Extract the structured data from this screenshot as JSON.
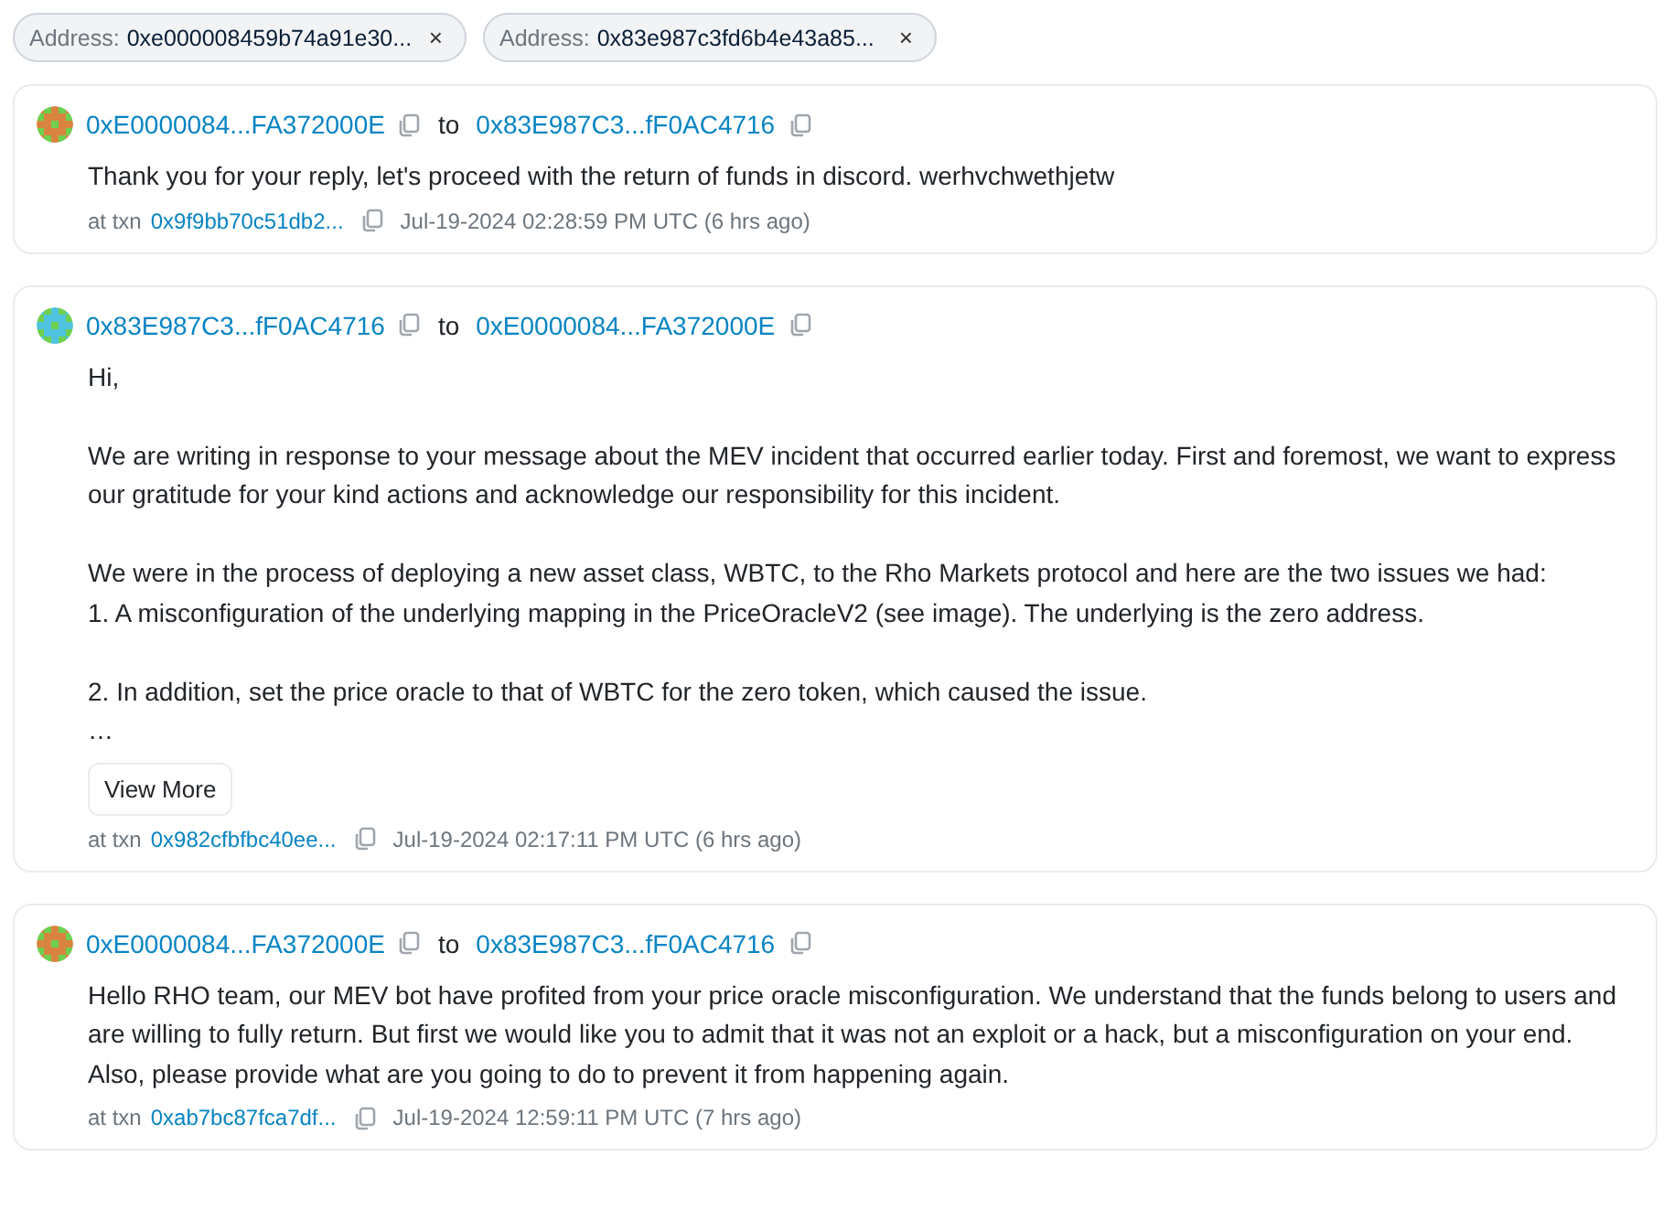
{
  "filters": [
    {
      "label": "Address:",
      "value": "0xe000008459b74a91e30...",
      "close": "×"
    },
    {
      "label": "Address:",
      "value": "0x83e987c3fd6b4e43a85...",
      "close": "×"
    }
  ],
  "messages": [
    {
      "color": "#d9843e",
      "from": "0xE0000084...FA372000E",
      "to_word": "to",
      "to": "0x83E987C3...fF0AC4716",
      "paragraphs": [
        [
          "Thank you for your reply, let's proceed with the return of funds in discord. werhvchwethjetw"
        ]
      ],
      "txn_label": "at txn",
      "txn": "0x9f9bb70c51db2...",
      "time": "Jul-19-2024 02:28:59 PM UTC (6 hrs ago)"
    },
    {
      "color": "#4fc3e0",
      "from": "0x83E987C3...fF0AC4716",
      "to_word": "to",
      "to": "0xE0000084...FA372000E",
      "paragraphs": [
        [
          "Hi,"
        ],
        [
          "We are writing in response to your message about the MEV incident that occurred earlier today. First and foremost, we want to express our gratitude for your kind actions and acknowledge our responsibility for this incident."
        ],
        [
          "We were in the process of deploying a new asset class, WBTC, to the Rho Markets protocol and here are the two issues we had:",
          "1. A misconfiguration of the underlying mapping in the PriceOracleV2 (see image). The underlying is the zero address."
        ],
        [
          "2. In addition, set the price oracle to that of WBTC for the zero token, which caused the issue.",
          "…"
        ]
      ],
      "view_more": "View More",
      "txn_label": "at txn",
      "txn": "0x982cfbfbc40ee...",
      "time": "Jul-19-2024 02:17:11 PM UTC (6 hrs ago)"
    },
    {
      "color": "#d9843e",
      "from": "0xE0000084...FA372000E",
      "to_word": "to",
      "to": "0x83E987C3...fF0AC4716",
      "paragraphs": [
        [
          "Hello RHO team, our MEV bot have profited from your price oracle misconfiguration. We understand that the funds belong to users and are willing to fully return. But first we would like you to admit that it was not an exploit or a hack, but a misconfiguration on your end. Also, please provide what are you going to do to prevent it from happening again."
        ]
      ],
      "txn_label": "at txn",
      "txn": "0xab7bc87fca7df...",
      "time": "Jul-19-2024 12:59:11 PM UTC (7 hrs ago)"
    }
  ]
}
